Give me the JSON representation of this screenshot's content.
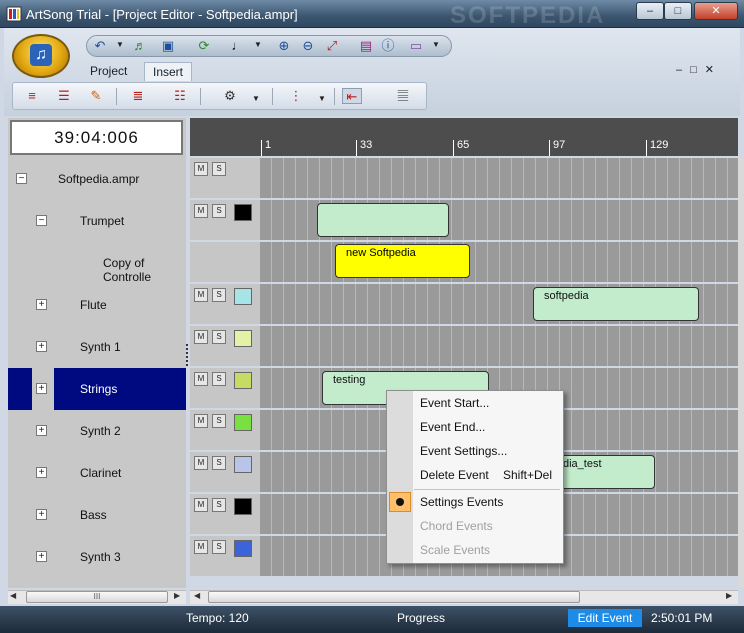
{
  "window": {
    "title": "ArtSong Trial - [Project Editor - Softpedia.ampr]",
    "min_glyph": "–",
    "max_glyph": "□",
    "close_glyph": "✕",
    "watermark": "SOFTPEDIA"
  },
  "ribbon": {
    "tabs": [
      {
        "label": "Project"
      },
      {
        "label": "Insert"
      }
    ],
    "window_controls": "–□✕",
    "quick_access_icons": [
      "undo-icon",
      "note-icon",
      "save-icon",
      "refresh-icon",
      "note-value-icon",
      "zoom-in-icon",
      "zoom-out-icon",
      "zoom-fit-icon",
      "book-icon",
      "info-icon",
      "window-icon"
    ],
    "insert_tool_icons": [
      "insert-track-icon",
      "insert-event-icon",
      "edit-icon",
      "insert-controller-icon",
      "insert-chord-icon",
      "tools-icon",
      "insert-marker-icon",
      "remove-icon",
      "keyboard-icon"
    ]
  },
  "tracks_panel": {
    "time": "39:04:006",
    "tracks": [
      {
        "label": "Softpedia.ampr",
        "expander": "−"
      },
      {
        "label": "Trumpet",
        "expander": "−"
      },
      {
        "label": "Copy of Controlle",
        "expander": ""
      },
      {
        "label": "Flute",
        "expander": "+"
      },
      {
        "label": "Synth 1",
        "expander": "+"
      },
      {
        "label": "Strings",
        "expander": "+",
        "selected": true
      },
      {
        "label": "Synth 2",
        "expander": "+"
      },
      {
        "label": "Clarinet",
        "expander": "+"
      },
      {
        "label": "Bass",
        "expander": "+"
      },
      {
        "label": "Synth 3",
        "expander": "+"
      }
    ],
    "scroll_grip": "III"
  },
  "timeline": {
    "ruler_marks": [
      "1",
      "33",
      "65",
      "97",
      "129"
    ],
    "mute_label": "M",
    "solo_label": "S",
    "track_colors": [
      "#000000",
      "#a6e4e8",
      "#e4f2a6",
      "#c6db64",
      "#78e040",
      "#b8c4e8",
      "#000000",
      "#3c64d8"
    ],
    "events": [
      {
        "label": ""
      },
      {
        "label": "new Softpedia"
      },
      {
        "label": "softpedia"
      },
      {
        "label": "testing"
      },
      {
        "label": "dia_test"
      }
    ]
  },
  "context_menu": {
    "items": [
      {
        "label": "Event Start...",
        "shortcut": ""
      },
      {
        "label": "Event End...",
        "shortcut": ""
      },
      {
        "label": "Event Settings...",
        "shortcut": ""
      },
      {
        "label": "Delete Event",
        "shortcut": "Shift+Del"
      },
      {
        "label": "Settings Events",
        "shortcut": "",
        "checked": true
      },
      {
        "label": "Chord Events",
        "shortcut": "",
        "disabled": true
      },
      {
        "label": "Scale Events",
        "shortcut": "",
        "disabled": true
      }
    ]
  },
  "status_bar": {
    "tempo": "Tempo:  120",
    "progress": "Progress",
    "mode": "Edit Event",
    "clock": "2:50:01 PM"
  },
  "colors": {
    "selected_track": "#000a80",
    "event_green": "#c2eccb",
    "event_yellow": "#ffff00",
    "status_mode": "#1e8ce6"
  }
}
